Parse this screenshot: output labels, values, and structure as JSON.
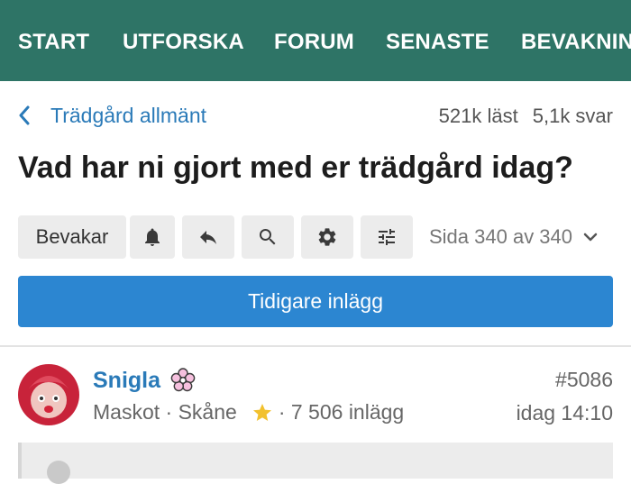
{
  "nav": {
    "items": [
      "START",
      "UTFORSKA",
      "FORUM",
      "SENASTE",
      "BEVAKNINGAR"
    ]
  },
  "thread": {
    "breadcrumb": "Trädgård allmänt",
    "reads": "521k läst",
    "replies": "5,1k svar",
    "title": "Vad har ni gjort med er trädgård idag?"
  },
  "toolbar": {
    "watch_label": "Bevakar",
    "icons": [
      "bell-icon",
      "reply-icon",
      "search-icon",
      "gear-icon",
      "sliders-icon"
    ],
    "page_info": "Sida 340 av 340"
  },
  "earlier_button": "Tidigare inlägg",
  "post": {
    "author": "Snigla",
    "role": "Maskot",
    "location": "Skåne",
    "posts_count": "7 506 inlägg",
    "post_number": "#5086",
    "time": "idag 14:10"
  },
  "colors": {
    "nav_bg": "#2e7466",
    "link": "#2a7ab8",
    "primary_button": "#2c86d1",
    "star": "#f2c12e"
  }
}
